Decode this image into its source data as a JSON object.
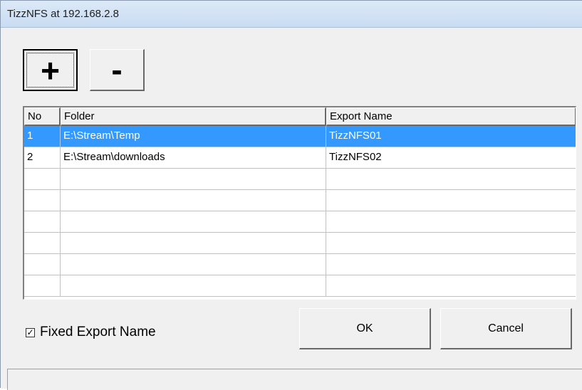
{
  "window": {
    "title": "TizzNFS at 192.168.2.8"
  },
  "toolbar": {
    "add_label": "+",
    "remove_label": "-"
  },
  "table": {
    "columns": [
      "No",
      "Folder",
      "Export Name"
    ],
    "rows": [
      {
        "no": "1",
        "folder": "E:\\Stream\\Temp",
        "export": "TizzNFS01",
        "selected": true
      },
      {
        "no": "2",
        "folder": "E:\\Stream\\downloads",
        "export": "TizzNFS02",
        "selected": false
      }
    ],
    "selection_color": "#3399ff"
  },
  "options": {
    "fixed_export_label": "Fixed Export Name",
    "fixed_export_checked": true,
    "check_mark": "✓"
  },
  "buttons": {
    "ok": "OK",
    "cancel": "Cancel"
  }
}
